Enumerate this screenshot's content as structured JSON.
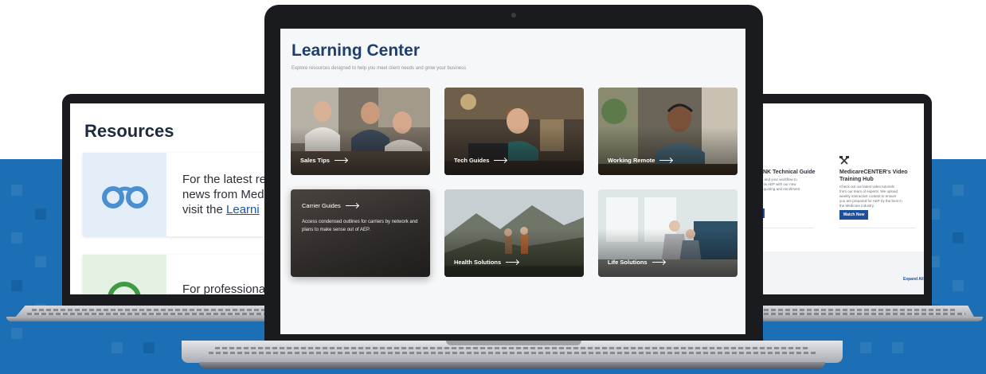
{
  "left_screen": {
    "title": "Resources",
    "card1_line1": "For the latest re",
    "card1_line2": "news from Med",
    "card1_line3_prefix": "visit the ",
    "card1_link": "Learni",
    "card2_text": "For professiona"
  },
  "main_screen": {
    "title": "Learning Center",
    "subtitle": "Explore resources designed to help you meet client needs and grow your business",
    "cards": [
      {
        "label": "Sales Tips"
      },
      {
        "label": "Tech Guides"
      },
      {
        "label": "Working Remote"
      },
      {
        "label": "Carrier Guides",
        "description": "Access condensed outlines for carriers by network and plans to make sense out of AEP."
      },
      {
        "label": "Health Solutions"
      },
      {
        "label": "Life Solutions"
      }
    ]
  },
  "right_screen": {
    "guide_title": "INK Technical Guide",
    "guide_text_1": "s and your workflow to",
    "guide_text_2": "this AEP with our new",
    "guide_text_3": "t quoting and enrollment",
    "hub_title_1": "MedicareCENTER's Video",
    "hub_title_2": "Training Hub",
    "hub_text_1": "Check out our latest video tutorials",
    "hub_text_2": "from our team of experts. We upload",
    "hub_text_3": "weekly interactive content to ensure",
    "hub_text_4": "you are prepared for AEP by the best in",
    "hub_text_5": "the Medicare industry.",
    "watch_button": "Watch Now",
    "expand_all": "Expand All"
  },
  "colors": {
    "band": "#1c6fb4",
    "title_navy": "#1f3e6e",
    "button_blue": "#1c4f9c"
  }
}
